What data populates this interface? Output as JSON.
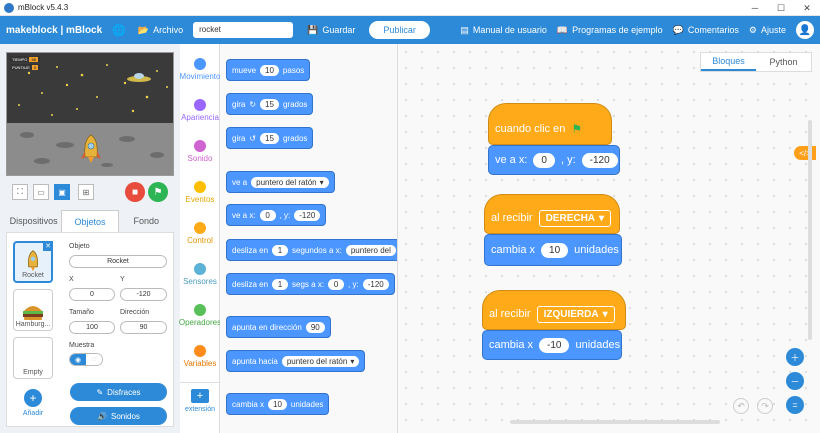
{
  "window": {
    "title": "mBlock v5.4.3"
  },
  "menubar": {
    "brand": "makeblock | mBlock",
    "archivo": "Archivo",
    "project_name": "rocket",
    "guardar": "Guardar",
    "publicar": "Publicar",
    "manual": "Manual de usuario",
    "programas": "Programas de ejemplo",
    "comentarios": "Comentarios",
    "ajuste": "Ajuste"
  },
  "stage": {
    "hud_time_label": "TIEMPO",
    "hud_time_value": "38",
    "hud_score_label": "PUNTAJE",
    "hud_score_value": "0"
  },
  "tabs": {
    "dispositivos": "Dispositivos",
    "objetos": "Objetos",
    "fondo": "Fondo"
  },
  "sprites": [
    {
      "name": "Rocket"
    },
    {
      "name": "Hamburg..."
    },
    {
      "name": "Empty"
    }
  ],
  "add_label": "Añadir",
  "props": {
    "objeto_label": "Objeto",
    "objeto_value": "Rocket",
    "x_label": "X",
    "x_value": "0",
    "y_label": "Y",
    "y_value": "-120",
    "tamano_label": "Tamaño",
    "tamano_value": "100",
    "direccion_label": "Dirección",
    "direccion_value": "90",
    "muestra_label": "Muestra"
  },
  "buttons": {
    "disfraces": "Disfraces",
    "sonidos": "Sonidos"
  },
  "categories": [
    {
      "label": "Movimiento",
      "color": "#4c97ff",
      "text_color": "#4c97ff"
    },
    {
      "label": "Apariencia",
      "color": "#9966ff",
      "text_color": "#9966ff"
    },
    {
      "label": "Sonido",
      "color": "#cf63cf",
      "text_color": "#cf63cf"
    },
    {
      "label": "Eventos",
      "color": "#ffbf00",
      "text_color": "#e6a800"
    },
    {
      "label": "Control",
      "color": "#ffab19",
      "text_color": "#e69500"
    },
    {
      "label": "Sensores",
      "color": "#5cb1d6",
      "text_color": "#4a9bc0"
    },
    {
      "label": "Operadores",
      "color": "#59c059",
      "text_color": "#45a845"
    },
    {
      "label": "Variables",
      "color": "#ff8c1a",
      "text_color": "#e67700"
    }
  ],
  "extension_label": "extensión",
  "palette": {
    "b1": {
      "a": "mueve",
      "v": "10",
      "b": "pasos"
    },
    "b2": {
      "a": "gira",
      "v": "15",
      "b": "grados"
    },
    "b3": {
      "a": "gira",
      "v": "15",
      "b": "grados"
    },
    "b4": {
      "a": "ve a",
      "d": "puntero del ratón"
    },
    "b5": {
      "a": "ve a x:",
      "x": "0",
      "c": ", y:",
      "y": "-120"
    },
    "b6": {
      "a": "desliza en",
      "v": "1",
      "b": "segundos a x:",
      "d": "puntero del"
    },
    "b7": {
      "a": "desliza en",
      "v": "1",
      "b": "segs a x:",
      "x": "0",
      "c": ", y:",
      "y": "-120"
    },
    "b8": {
      "a": "apunta en dirección",
      "v": "90"
    },
    "b9": {
      "a": "apunta hacia",
      "d": "puntero del ratón"
    },
    "b10": {
      "a": "cambia x",
      "v": "10",
      "b": "unidades"
    }
  },
  "code": {
    "tab_bloques": "Bloques",
    "tab_python": "Python",
    "s1_hat": "cuando clic en",
    "s1_a": "ve a x:",
    "s1_x": "0",
    "s1_c": ", y:",
    "s1_y": "-120",
    "s2_hat": "al recibir",
    "s2_msg": "DERECHA",
    "s2_a": "cambia x",
    "s2_v": "10",
    "s2_b": "unidades",
    "s3_hat": "al recibir",
    "s3_msg": "IZQUIERDA",
    "s3_a": "cambia x",
    "s3_v": "-10",
    "s3_b": "unidades"
  }
}
